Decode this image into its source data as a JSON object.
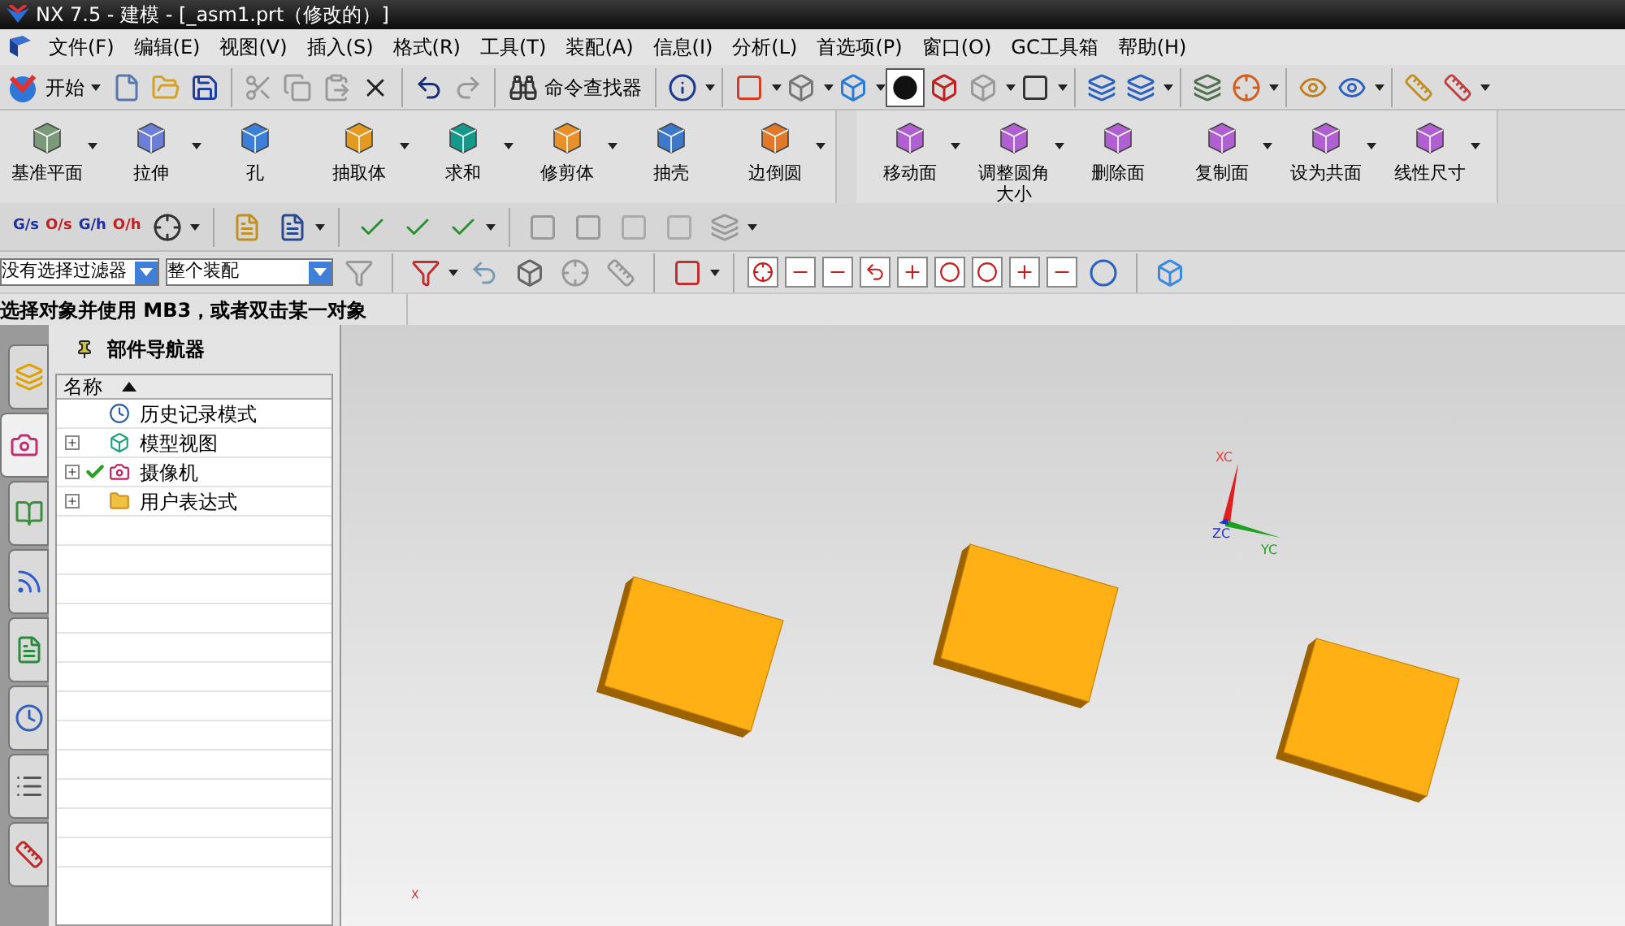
{
  "window": {
    "title": "NX 7.5 - 建模 - [_asm1.prt（修改的）]"
  },
  "menu": [
    "文件(F)",
    "编辑(E)",
    "视图(V)",
    "插入(S)",
    "格式(R)",
    "工具(T)",
    "装配(A)",
    "信息(I)",
    "分析(L)",
    "首选项(P)",
    "窗口(O)",
    "GC工具箱",
    "帮助(H)"
  ],
  "standard_toolbar": {
    "start_button": "开始",
    "command_finder": "命令查找器"
  },
  "feature_toolbar": [
    {
      "label": "基准平面",
      "dropdown": true
    },
    {
      "label": "拉伸",
      "dropdown": true
    },
    {
      "label": "孔",
      "dropdown": false
    },
    {
      "label": "抽取体",
      "dropdown": true
    },
    {
      "label": "求和",
      "dropdown": true
    },
    {
      "label": "修剪体",
      "dropdown": true
    },
    {
      "label": "抽壳",
      "dropdown": false
    },
    {
      "label": "边倒圆",
      "dropdown": true
    }
  ],
  "sync_toolbar": [
    {
      "label": "移动面",
      "dropdown": true
    },
    {
      "label": "调整圆角大小",
      "dropdown": true
    },
    {
      "label": "删除面",
      "dropdown": false
    },
    {
      "label": "复制面",
      "dropdown": true
    },
    {
      "label": "设为共面",
      "dropdown": true
    },
    {
      "label": "线性尺寸",
      "dropdown": true
    }
  ],
  "surface_toolbar": [
    "G/s",
    "O/s",
    "G/h",
    "O/h"
  ],
  "selection_bar": {
    "filter": "没有选择过滤器",
    "scope": "整个装配"
  },
  "status_prompt": "选择对象并使用 MB3，或者双击某一对象",
  "resource_tabs": [
    {
      "selected": false
    },
    {
      "selected": true
    },
    {
      "selected": false
    },
    {
      "selected": false
    },
    {
      "selected": false
    },
    {
      "selected": false
    },
    {
      "selected": false
    },
    {
      "selected": false
    }
  ],
  "navigator": {
    "title": "部件导航器",
    "column": "名称",
    "nodes": [
      {
        "label": "历史记录模式",
        "checked": false
      },
      {
        "label": "模型视图",
        "expanded": false,
        "checked": false
      },
      {
        "label": "摄像机",
        "expanded": false,
        "checked": true
      },
      {
        "label": "用户表达式",
        "expanded": false,
        "checked": false
      }
    ]
  },
  "viewport": {
    "triad": {
      "x_label": "XC",
      "y_label": "YC",
      "z_label": "ZC"
    },
    "corner_label": "X"
  }
}
